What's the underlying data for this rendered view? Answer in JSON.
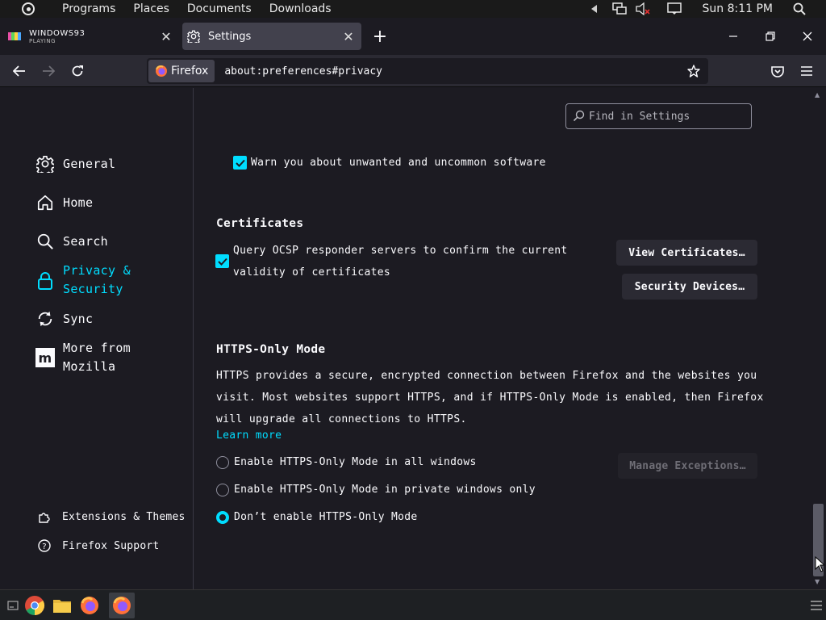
{
  "system_bar": {
    "menu": [
      "Programs",
      "Places",
      "Documents",
      "Downloads"
    ],
    "clock": "Sun 8:11 PM"
  },
  "tabs": [
    {
      "title": "WINDOWS93",
      "subtitle": "PLAYING"
    },
    {
      "title": "Settings"
    }
  ],
  "navbar": {
    "identity_label": "Firefox",
    "url": "about:preferences#privacy"
  },
  "sidebar": {
    "categories": [
      {
        "label": "General"
      },
      {
        "label": "Home"
      },
      {
        "label": "Search"
      },
      {
        "label_line1": "Privacy &",
        "label_line2": "Security"
      },
      {
        "label": "Sync"
      },
      {
        "label_line1": "More from",
        "label_line2": "Mozilla"
      }
    ],
    "footer": [
      "Extensions & Themes",
      "Firefox Support"
    ]
  },
  "search": {
    "placeholder": "Find in Settings"
  },
  "security": {
    "warn_unwanted": "Warn you about unwanted and uncommon software"
  },
  "certificates": {
    "heading": "Certificates",
    "ocsp_line1": "Query OCSP responder servers to confirm the current",
    "ocsp_line2": "validity of certificates",
    "view_button": "View Certificates…",
    "devices_button": "Security Devices…"
  },
  "https_only": {
    "heading": "HTTPS-Only Mode",
    "description": "HTTPS provides a secure, encrypted connection between Firefox and the websites you visit. Most websites support HTTPS, and if HTTPS-Only Mode is enabled, then Firefox will upgrade all connections to HTTPS.",
    "learn_more": "Learn more",
    "options": [
      "Enable HTTPS-Only Mode in all windows",
      "Enable HTTPS-Only Mode in private windows only",
      "Don’t enable HTTPS-Only Mode"
    ],
    "selected_option": 2,
    "manage_button": "Manage Exceptions…"
  },
  "colors": {
    "accent": "#00ddff",
    "background": "#1c1b22",
    "toolbar": "#2b2a33"
  }
}
